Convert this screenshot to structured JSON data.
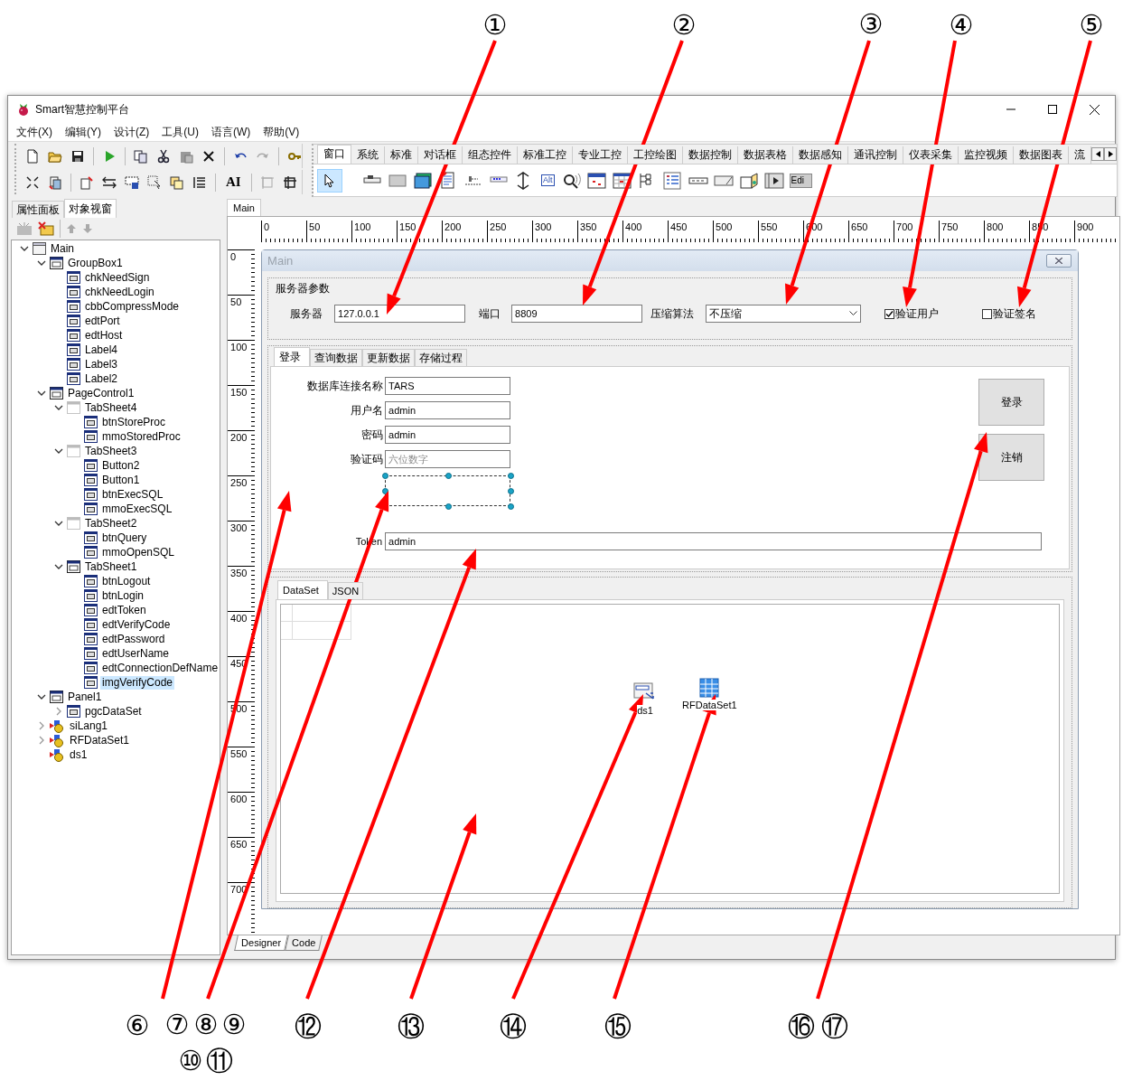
{
  "callouts": [
    "①",
    "②",
    "③",
    "④",
    "⑤",
    "⑥",
    "⑦",
    "⑧",
    "⑨",
    "⑩",
    "⑪",
    "⑫",
    "⑬",
    "⑭",
    "⑮",
    "⑯",
    "⑰"
  ],
  "window": {
    "title": "Smart智慧控制平台"
  },
  "menu": [
    "文件(X)",
    "编辑(Y)",
    "设计(Z)",
    "工具(U)",
    "语言(W)",
    "帮助(V)"
  ],
  "toolbar": {
    "font_tool": "AI"
  },
  "palette": {
    "tabs": [
      {
        "label": "窗口",
        "selected": true
      },
      {
        "label": "系统",
        "selected": false
      },
      {
        "label": "标准",
        "selected": false
      },
      {
        "label": "对话框",
        "selected": false
      },
      {
        "label": "组态控件",
        "selected": false
      },
      {
        "label": "标准工控",
        "selected": false
      },
      {
        "label": "专业工控",
        "selected": false
      },
      {
        "label": "工控绘图",
        "selected": false
      },
      {
        "label": "数据控制",
        "selected": false
      },
      {
        "label": "数据表格",
        "selected": false
      },
      {
        "label": "数据感知",
        "selected": false
      },
      {
        "label": "通讯控制",
        "selected": false
      },
      {
        "label": "仪表采集",
        "selected": false
      },
      {
        "label": "监控视频",
        "selected": false
      },
      {
        "label": "数据图表",
        "selected": false
      },
      {
        "label": "流",
        "selected": false
      }
    ],
    "alt_label": "Alt",
    "edit_label": "Edi"
  },
  "left_panel": {
    "tabs": [
      {
        "label": "属性面板",
        "selected": false
      },
      {
        "label": "对象视窗",
        "selected": true
      }
    ],
    "tree": [
      {
        "label": "Main",
        "kind": "form",
        "expanded": true,
        "selected": false,
        "children": [
          {
            "label": "GroupBox1",
            "kind": "container",
            "expanded": true,
            "selected": false,
            "children": [
              {
                "label": "chkNeedSign",
                "kind": "control",
                "selected": false
              },
              {
                "label": "chkNeedLogin",
                "kind": "control",
                "selected": false
              },
              {
                "label": "cbbCompressMode",
                "kind": "control",
                "selected": false
              },
              {
                "label": "edtPort",
                "kind": "control",
                "selected": false
              },
              {
                "label": "edtHost",
                "kind": "control",
                "selected": false
              },
              {
                "label": "Label4",
                "kind": "control",
                "selected": false
              },
              {
                "label": "Label3",
                "kind": "control",
                "selected": false
              },
              {
                "label": "Label2",
                "kind": "control",
                "selected": false
              }
            ]
          },
          {
            "label": "PageControl1",
            "kind": "container",
            "expanded": true,
            "selected": false,
            "children": [
              {
                "label": "TabSheet4",
                "kind": "tabsheet",
                "expanded": true,
                "selected": false,
                "children": [
                  {
                    "label": "btnStoreProc",
                    "kind": "control",
                    "selected": false
                  },
                  {
                    "label": "mmoStoredProc",
                    "kind": "control",
                    "selected": false
                  }
                ]
              },
              {
                "label": "TabSheet3",
                "kind": "tabsheet",
                "expanded": true,
                "selected": false,
                "children": [
                  {
                    "label": "Button2",
                    "kind": "control",
                    "selected": false
                  },
                  {
                    "label": "Button1",
                    "kind": "control",
                    "selected": false
                  },
                  {
                    "label": "btnExecSQL",
                    "kind": "control",
                    "selected": false
                  },
                  {
                    "label": "mmoExecSQL",
                    "kind": "control",
                    "selected": false
                  }
                ]
              },
              {
                "label": "TabSheet2",
                "kind": "tabsheet",
                "expanded": true,
                "selected": false,
                "children": [
                  {
                    "label": "btnQuery",
                    "kind": "control",
                    "selected": false
                  },
                  {
                    "label": "mmoOpenSQL",
                    "kind": "control",
                    "selected": false
                  }
                ]
              },
              {
                "label": "TabSheet1",
                "kind": "container",
                "expanded": true,
                "selected": false,
                "children": [
                  {
                    "label": "btnLogout",
                    "kind": "control",
                    "selected": false
                  },
                  {
                    "label": "btnLogin",
                    "kind": "control",
                    "selected": false
                  },
                  {
                    "label": "edtToken",
                    "kind": "control",
                    "selected": false
                  },
                  {
                    "label": "edtVerifyCode",
                    "kind": "control",
                    "selected": false
                  },
                  {
                    "label": "edtPassword",
                    "kind": "control",
                    "selected": false
                  },
                  {
                    "label": "edtUserName",
                    "kind": "control",
                    "selected": false
                  },
                  {
                    "label": "edtConnectionDefName",
                    "kind": "control",
                    "selected": false
                  },
                  {
                    "label": "imgVerifyCode",
                    "kind": "control",
                    "selected": true
                  }
                ]
              }
            ]
          },
          {
            "label": "Panel1",
            "kind": "container",
            "expanded": true,
            "selected": false,
            "children": [
              {
                "label": "pgcDataSet",
                "kind": "control",
                "expanded": false,
                "selected": false
              }
            ]
          },
          {
            "label": "siLang1",
            "kind": "nonvisual",
            "expanded": false,
            "selected": false
          },
          {
            "label": "RFDataSet1",
            "kind": "nonvisual",
            "expanded": false,
            "selected": false
          },
          {
            "label": "ds1",
            "kind": "nonvisual",
            "selected": false
          }
        ]
      }
    ]
  },
  "designer": {
    "tab": "Main",
    "ruler": {
      "horizontal": [
        "0",
        "50",
        "100",
        "150",
        "200",
        "250",
        "300",
        "350",
        "400",
        "450",
        "500",
        "550",
        "600",
        "650",
        "700",
        "750",
        "800",
        "850",
        "900"
      ],
      "vertical": [
        "0",
        "50",
        "100",
        "150",
        "200",
        "250",
        "300",
        "350",
        "400",
        "450",
        "500",
        "550",
        "600",
        "650",
        "700"
      ]
    },
    "form": {
      "title": "Main",
      "server_group": {
        "title": "服务器参数",
        "fields": [
          {
            "label": "服务器",
            "value": "127.0.0.1"
          },
          {
            "label": "端口",
            "value": "8809"
          }
        ],
        "compress": {
          "label": "压缩算法",
          "value": "不压缩"
        },
        "checks": [
          {
            "label": "验证用户",
            "checked": true
          },
          {
            "label": "验证签名",
            "checked": false
          }
        ]
      },
      "page_tabs": [
        {
          "label": "登录",
          "selected": true
        },
        {
          "label": "查询数据",
          "selected": false
        },
        {
          "label": "更新数据",
          "selected": false
        },
        {
          "label": "存储过程",
          "selected": false
        }
      ],
      "login": {
        "fields": [
          {
            "label": "数据库连接名称",
            "value": "TARS"
          },
          {
            "label": "用户名",
            "value": "admin"
          },
          {
            "label": "密码",
            "value": "admin"
          },
          {
            "label": "验证码",
            "placeholder": "六位数字"
          }
        ],
        "token": {
          "label": "Token",
          "value": "admin"
        },
        "buttons": [
          "登录",
          "注销"
        ]
      },
      "data_tabs": [
        {
          "label": "DataSet",
          "selected": true
        },
        {
          "label": "JSON",
          "selected": false
        }
      ],
      "components": [
        {
          "label": "ds1",
          "kind": "datasource"
        },
        {
          "label": "RFDataSet1",
          "kind": "dataset"
        }
      ]
    },
    "bottom_tabs": [
      {
        "label": "Designer",
        "selected": true
      },
      {
        "label": "Code",
        "selected": false
      }
    ]
  }
}
